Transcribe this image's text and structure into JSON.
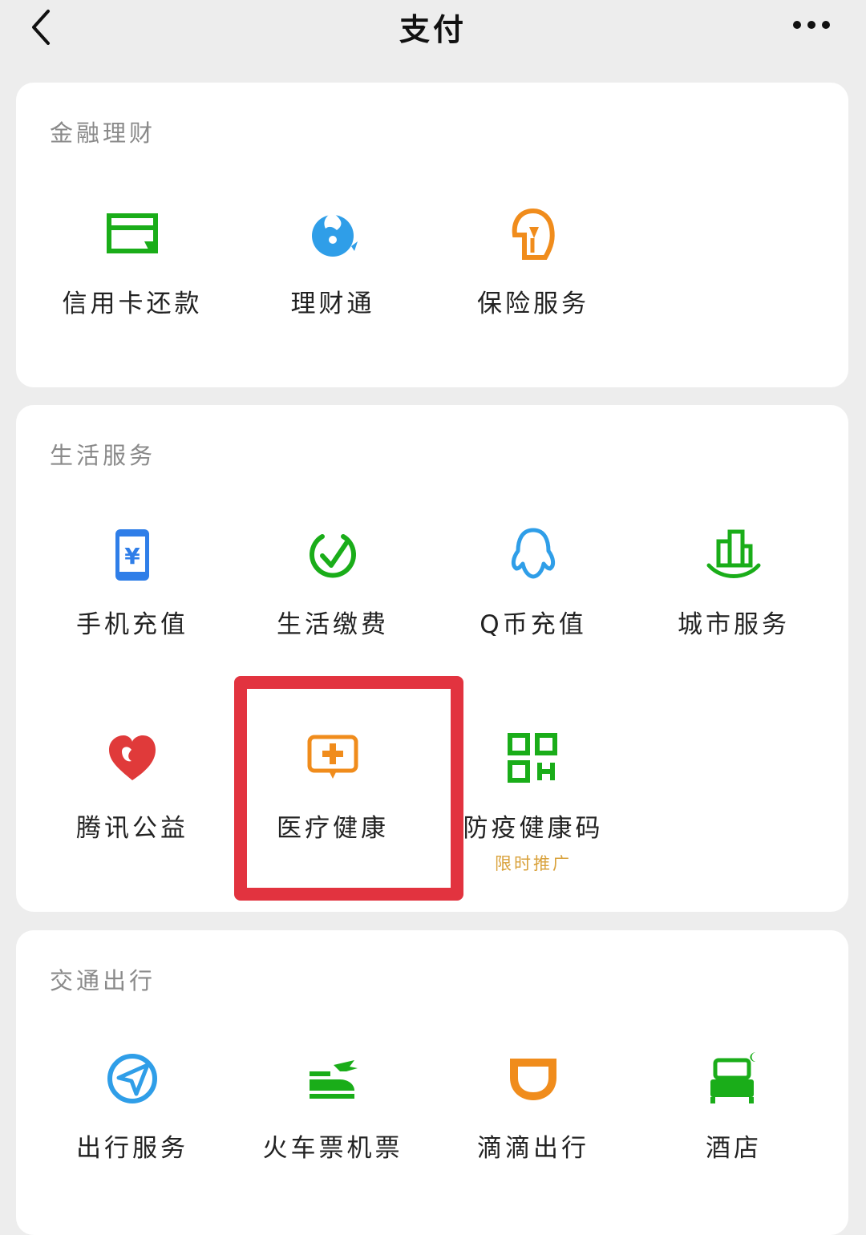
{
  "header": {
    "title": "支付",
    "back_icon": "chevron-left-icon",
    "more_icon": "more-dots-icon"
  },
  "sections": {
    "finance": {
      "title": "金融理财",
      "items": [
        {
          "label": "信用卡还款",
          "icon": "credit-card-icon",
          "color": "#1aad19"
        },
        {
          "label": "理财通",
          "icon": "wealth-icon",
          "color": "#2f9ee8"
        },
        {
          "label": "保险服务",
          "icon": "insurance-umbrella-icon",
          "color": "#f08c1c"
        }
      ]
    },
    "life": {
      "title": "生活服务",
      "items": [
        {
          "label": "手机充值",
          "icon": "phone-topup-icon",
          "color": "#2f7ee8"
        },
        {
          "label": "生活缴费",
          "icon": "utility-check-icon",
          "color": "#1aad19"
        },
        {
          "label": "Q币充值",
          "icon": "qq-penguin-icon",
          "color": "#2f9ee8"
        },
        {
          "label": "城市服务",
          "icon": "city-building-icon",
          "color": "#1aad19"
        },
        {
          "label": "腾讯公益",
          "icon": "charity-heart-icon",
          "color": "#e03a3a"
        },
        {
          "label": "医疗健康",
          "icon": "medical-chat-icon",
          "color": "#f08c1c"
        },
        {
          "label": "防疫健康码",
          "icon": "qr-code-icon",
          "color": "#1aad19",
          "badge": "限时推广"
        }
      ]
    },
    "travel": {
      "title": "交通出行",
      "items": [
        {
          "label": "出行服务",
          "icon": "navigation-arrow-icon",
          "color": "#2f9ee8"
        },
        {
          "label": "火车票机票",
          "icon": "train-plane-icon",
          "color": "#1aad19"
        },
        {
          "label": "滴滴出行",
          "icon": "didi-icon",
          "color": "#f08c1c"
        },
        {
          "label": "酒店",
          "icon": "hotel-bed-icon",
          "color": "#1aad19"
        }
      ]
    }
  },
  "colors": {
    "highlight": "#e2333f",
    "badge": "#d9a23c",
    "background": "#ededed"
  }
}
